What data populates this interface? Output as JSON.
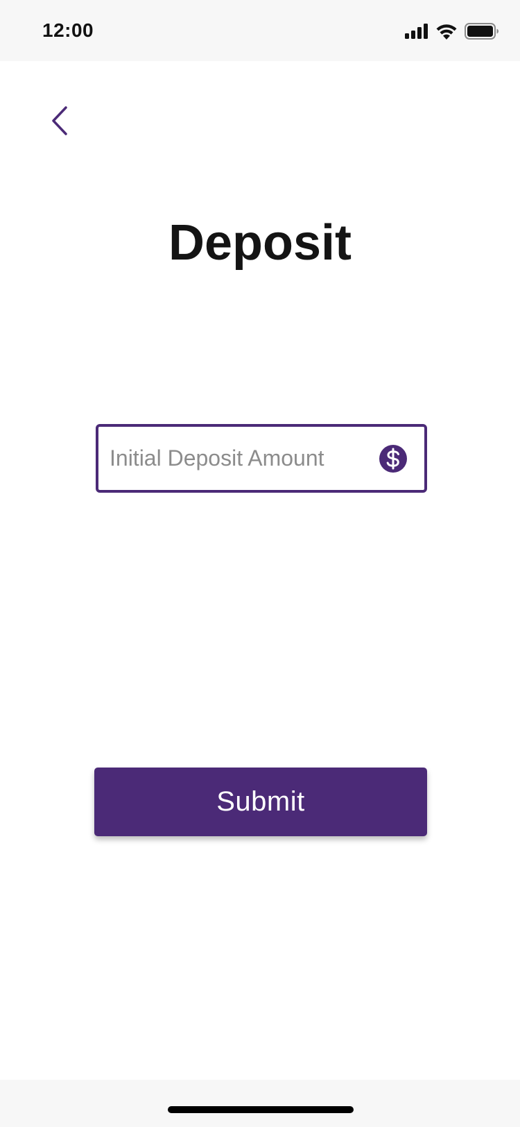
{
  "status_bar": {
    "time": "12:00",
    "icons": [
      "cellular-signal-icon",
      "wifi-icon",
      "battery-icon"
    ]
  },
  "nav": {
    "back_icon": "chevron-left-icon"
  },
  "page": {
    "title": "Deposit"
  },
  "deposit_field": {
    "placeholder": "Initial Deposit Amount",
    "value": "",
    "icon": "dollar-circle-icon"
  },
  "submit": {
    "label": "Submit"
  },
  "colors": {
    "accent": "#4b2a77",
    "title_text": "#141414",
    "placeholder_text": "#8c8c8c",
    "bar_background": "#f7f7f7"
  }
}
